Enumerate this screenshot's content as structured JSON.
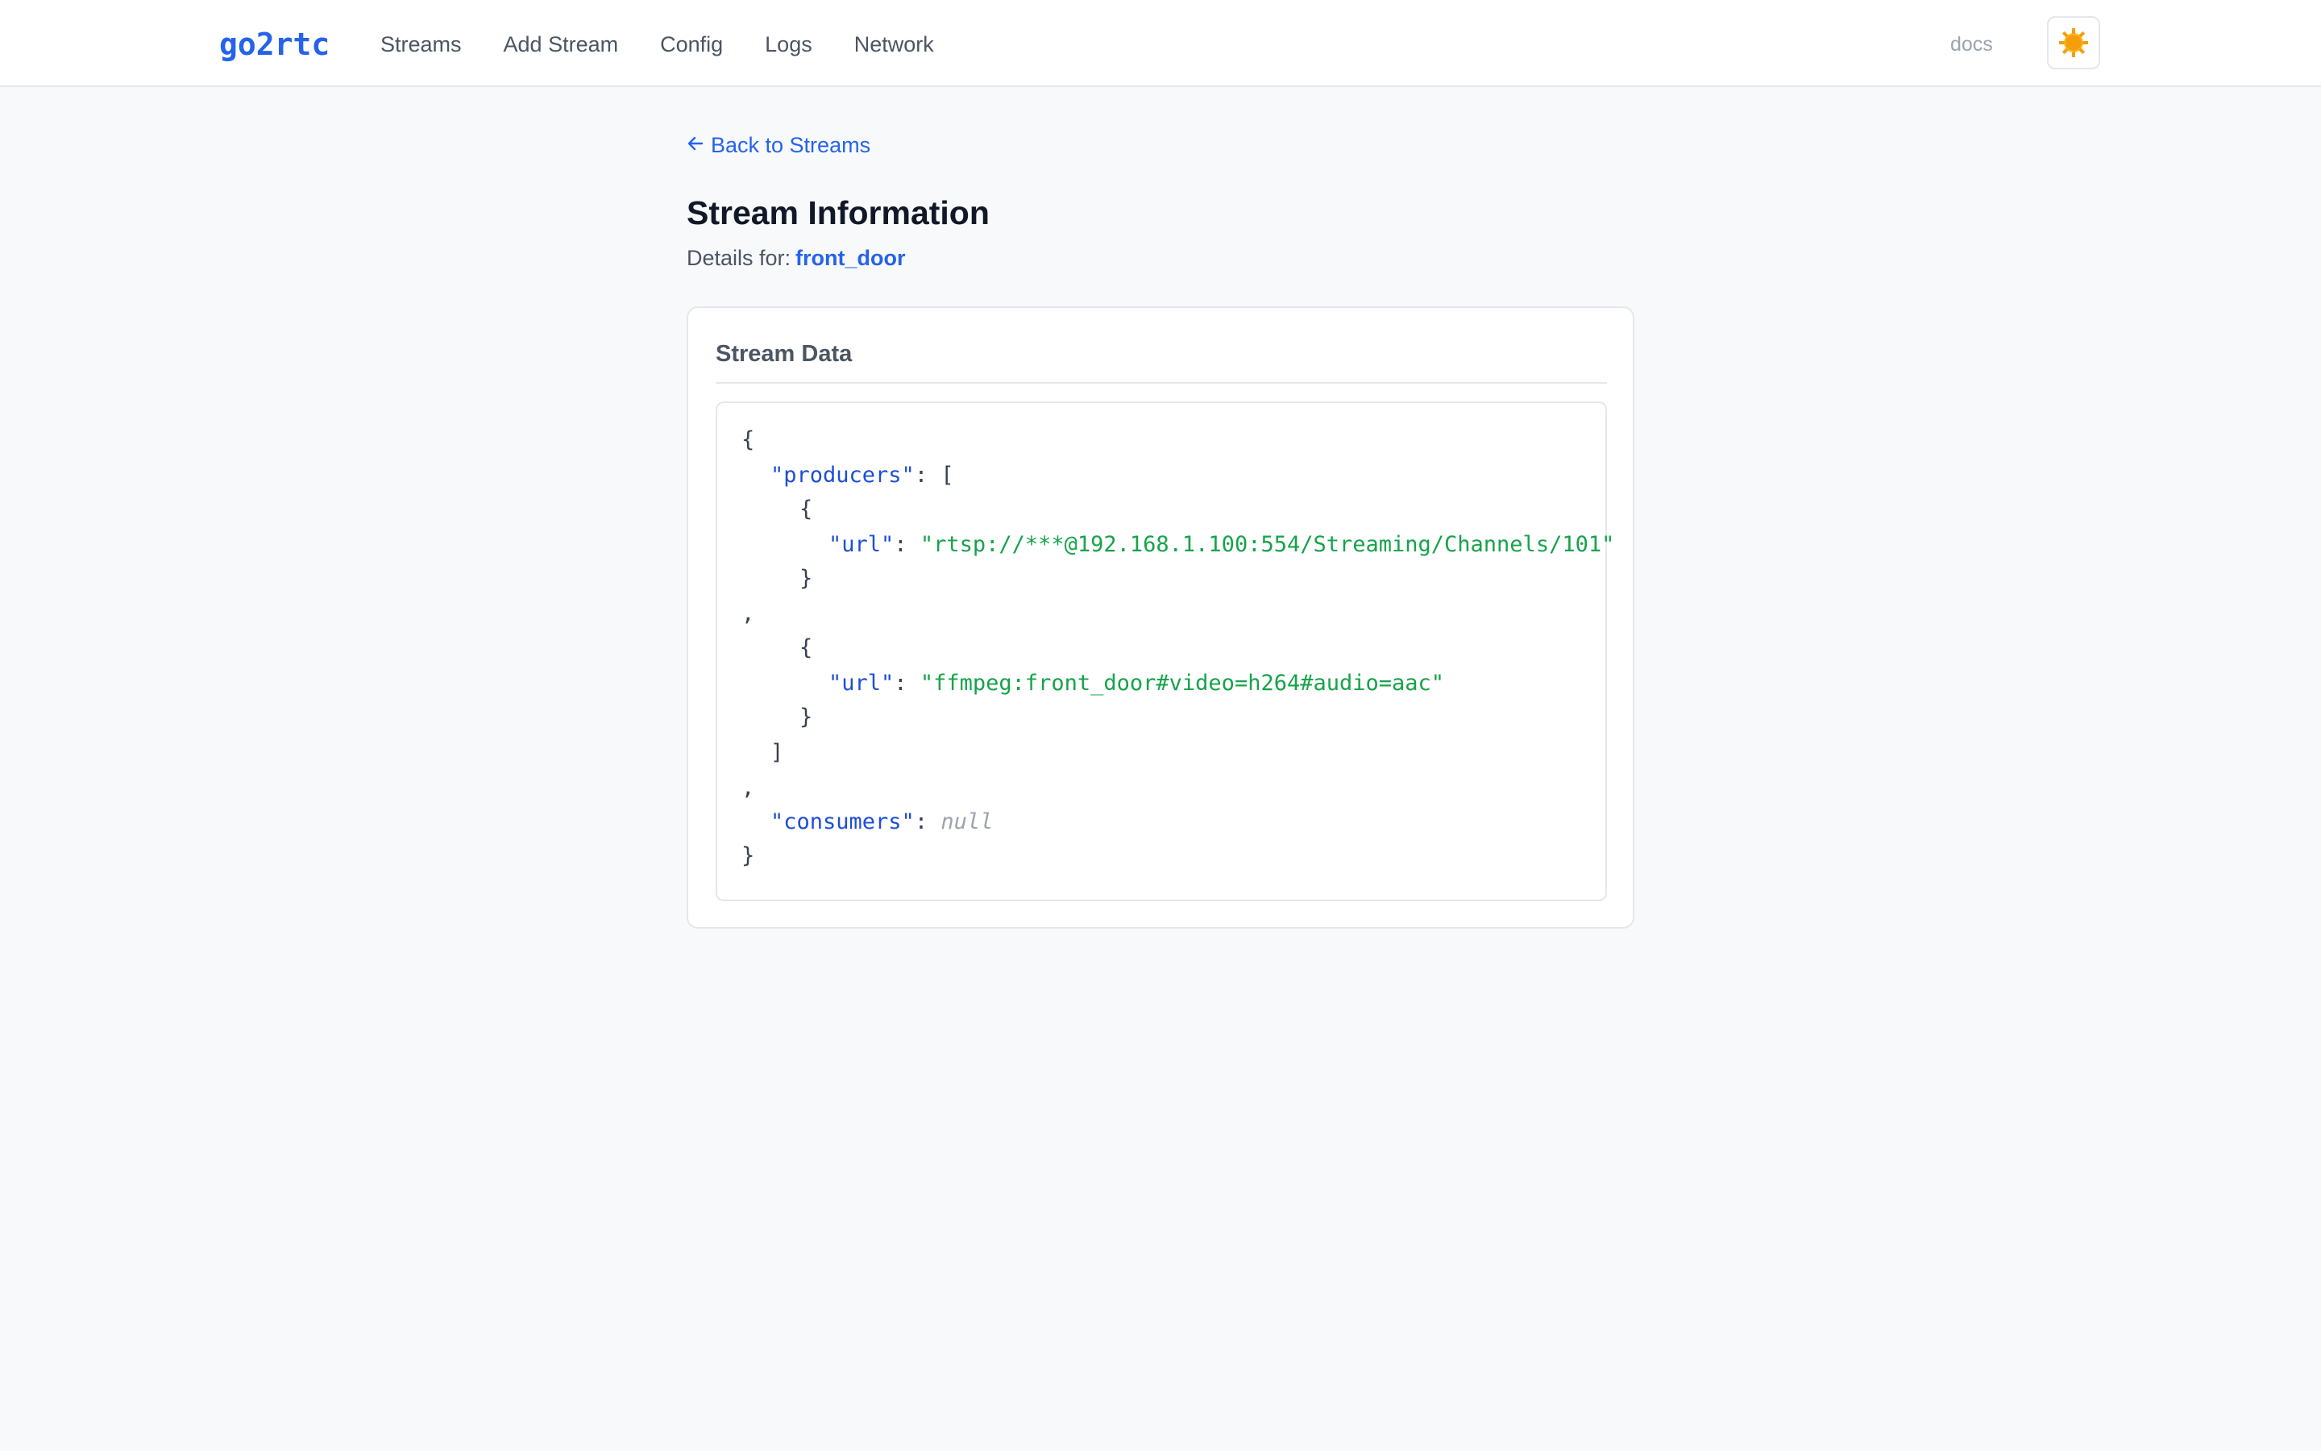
{
  "header": {
    "logo": "go2rtc",
    "nav": [
      {
        "label": "Streams"
      },
      {
        "label": "Add Stream"
      },
      {
        "label": "Config"
      },
      {
        "label": "Logs"
      },
      {
        "label": "Network"
      }
    ],
    "docs_label": "docs",
    "theme_icon": "sun-icon"
  },
  "main": {
    "back_label": "Back to Streams",
    "back_icon": "arrow-left-icon",
    "title": "Stream Information",
    "details_prefix": "Details for:",
    "stream_name": "front_door"
  },
  "card": {
    "title": "Stream Data",
    "json": {
      "open_brace": "{",
      "producers_key": "\"producers\"",
      "colon": ":",
      "open_bracket": "[",
      "item_open": "{",
      "url_key": "\"url\"",
      "producer_1_url": "\"rtsp://***@192.168.1.100:554/Streaming/Channels/101\"",
      "item_close": "}",
      "comma": ",",
      "producer_2_url": "\"ffmpeg:front_door#video=h264#audio=aac\"",
      "close_bracket": "]",
      "consumers_key": "\"consumers\"",
      "consumers_value": "null",
      "close_brace": "}"
    }
  },
  "colors": {
    "accent": "#2563eb",
    "json_key": "#1d4ed8",
    "json_string": "#16a34a",
    "json_null": "#9ca3af",
    "background": "#f8f9fb"
  }
}
